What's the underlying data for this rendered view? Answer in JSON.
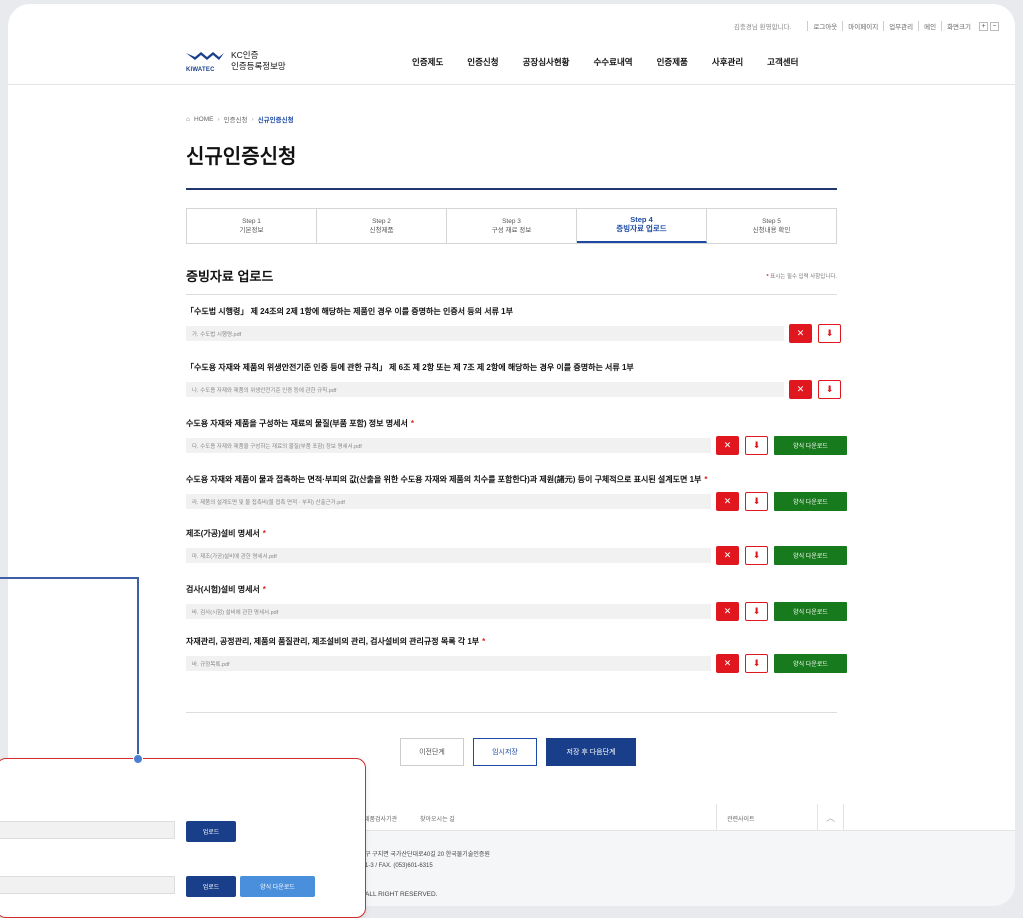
{
  "util": {
    "welcome": "김충경님 환영합니다.",
    "links": [
      "로그아웃",
      "마이페이지",
      "업무관리",
      "메인",
      "화면크기"
    ],
    "zoom_in": "+",
    "zoom_out": "−"
  },
  "logo": {
    "word": "KIWATEC",
    "line1": "KC인증",
    "line2": "인증등록정보망"
  },
  "gnb": [
    "인증제도",
    "인증신청",
    "공장심사현황",
    "수수료내역",
    "인증제품",
    "사후관리",
    "고객센터"
  ],
  "breadcrumb": {
    "home": "HOME",
    "level1": "인증신청",
    "current": "신규인증신청",
    "separator": "›"
  },
  "page_title": "신규인증신청",
  "steps": [
    {
      "num": "Step 1",
      "label": "기본정보"
    },
    {
      "num": "Step 2",
      "label": "신청제품"
    },
    {
      "num": "Step 3",
      "label": "구성 재료 정보"
    },
    {
      "num": "Step 4",
      "label": "증빙자료 업로드"
    },
    {
      "num": "Step 5",
      "label": "신청내용 확인"
    }
  ],
  "section": {
    "title": "증빙자료 업로드",
    "req_star": "*",
    "req_text": "표시는 필수 입력 사항입니다."
  },
  "items": [
    {
      "label": "「수도법 시행령」 제 24조의 2제 1항에 해당하는 제품인 경우 이를 증명하는 인증서 등의 서류 1부",
      "required": "",
      "file": "가. 수도법 시행령.pdf"
    },
    {
      "label": "「수도용 자재와 제품의 위생안전기준 인증 등에 관한 규칙」 제 6조 제 2항 또는 제 7조 제 2항에 해당하는 경우 이를 증명하는 서류 1부",
      "required": "",
      "file": "나. 수도용 자재와 제품의 위생안전기준 인증 등에 관한 규칙.pdf"
    },
    {
      "label": "수도용 자재와 제품을 구성하는 재료의 물질(부품 포함) 정보 명세서",
      "required": "*",
      "file": "다. 수도용 자재와 제품을 구성하는 재료의 물질(부품 포함) 정보 명세서.pdf"
    },
    {
      "label": "수도용 자재와 제품이 물과 접촉하는 면적·부피의 값(산출을 위한 수도용 자재와 제품의 치수를 포함한다)과 제원(諸元) 등이 구체적으로 표시된 설계도면 1부",
      "required": "*",
      "file": "라. 제품의 설계도면 및 물 접촉비(물 접촉 면적 · 부피) 산출근거.pdf"
    },
    {
      "label": "제조(가공)설비 명세서",
      "required": "*",
      "file": "마. 제조(가공)설비에 관한 명세서.pdf"
    },
    {
      "label": "검사(시험)설비 명세서",
      "required": "*",
      "file": "바. 검사(시험) 설비에 관한 명세서.pdf"
    },
    {
      "label": "자재관리, 공정관리, 제품의 품질관리, 제조설비의 관리, 검사설비의 관리규정 목록 각 1부",
      "required": "*",
      "file": "바. 규정목록.pdf"
    }
  ],
  "buttons": {
    "delete": "✕",
    "download": "⬇",
    "form_download": "양식 다운로드"
  },
  "actions": {
    "prev": "이전단계",
    "temp_save": "임시저장",
    "save_next": "저장 후 다음단계"
  },
  "footer": {
    "link1": "제품검사기관",
    "link2": "찾아오시는 길",
    "related": "관련사이트",
    "up": "︿",
    "addr": "구 구지면 국가산단대로40길 20 한국물기술인증원",
    "tel": "1-3 / FAX. (053)601-6315",
    "copy": "ALL RIGHT RESERVED."
  },
  "callout": {
    "upload": "업로드",
    "form_download": "양식 다운로드"
  },
  "colors": {
    "primary": "#1a3f8a",
    "danger": "#e0171e",
    "success": "#177a1c",
    "accent": "#4a8fdc"
  }
}
